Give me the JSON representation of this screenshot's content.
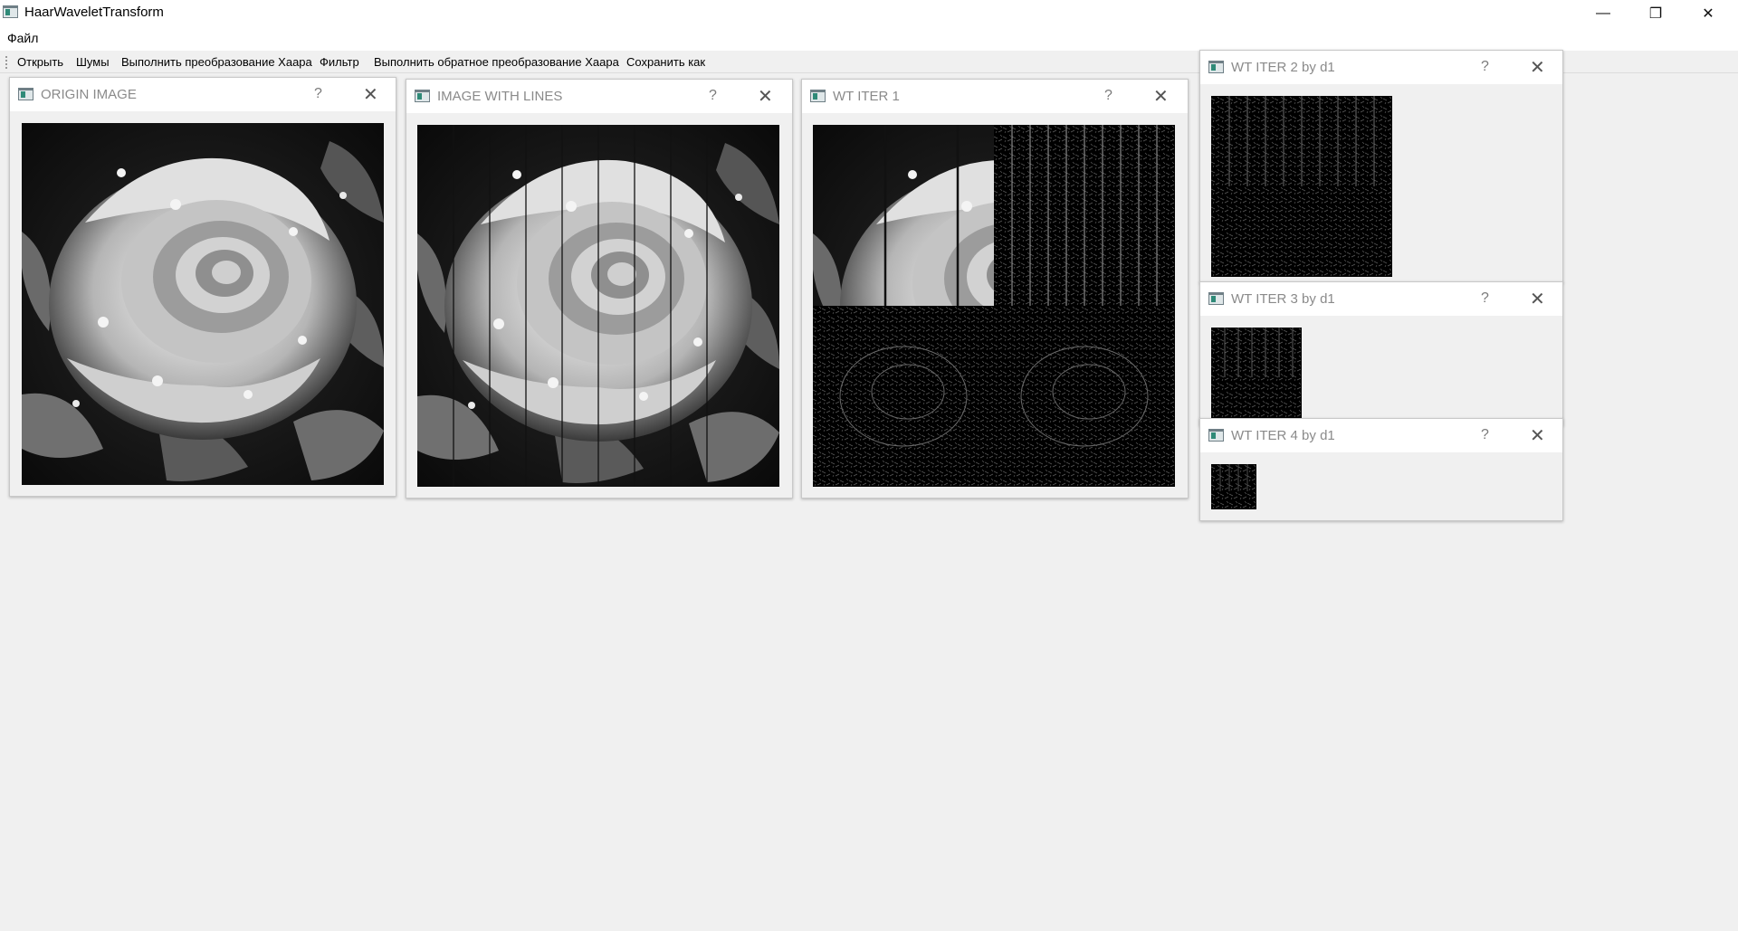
{
  "window": {
    "title": "HaarWaveletTransform",
    "minimize_glyph": "—",
    "restore_glyph": "❐",
    "close_glyph": "✕"
  },
  "menu": {
    "items": [
      "Файл"
    ]
  },
  "toolbar": {
    "items": [
      "Открыть",
      "Шумы",
      "Выполнить преобразование Хаара",
      "Фильтр",
      "Выполнить обратное преобразование Хаара",
      "Сохранить как"
    ]
  },
  "subwindows": [
    {
      "title": "ORIGIN IMAGE",
      "help": "?",
      "close": "✕",
      "image": "rose-grayscale"
    },
    {
      "title": "IMAGE WITH LINES",
      "help": "?",
      "close": "✕",
      "image": "rose-with-vertical-lines"
    },
    {
      "title": "WT ITER 1",
      "help": "?",
      "close": "✕",
      "image": "haar-wavelet-iteration-1"
    },
    {
      "title": "WT ITER 2 by d1",
      "help": "?",
      "close": "✕",
      "image": "haar-wavelet-detail-iteration-2"
    },
    {
      "title": "WT ITER 3 by d1",
      "help": "?",
      "close": "✕",
      "image": "haar-wavelet-detail-iteration-3"
    },
    {
      "title": "WT ITER 4 by d1",
      "help": "?",
      "close": "✕",
      "image": "haar-wavelet-detail-iteration-4"
    }
  ],
  "colors": {
    "background": "#f0f0f0",
    "titlebar": "#ffffff",
    "subwindow_title_text": "#8a8a8a"
  }
}
